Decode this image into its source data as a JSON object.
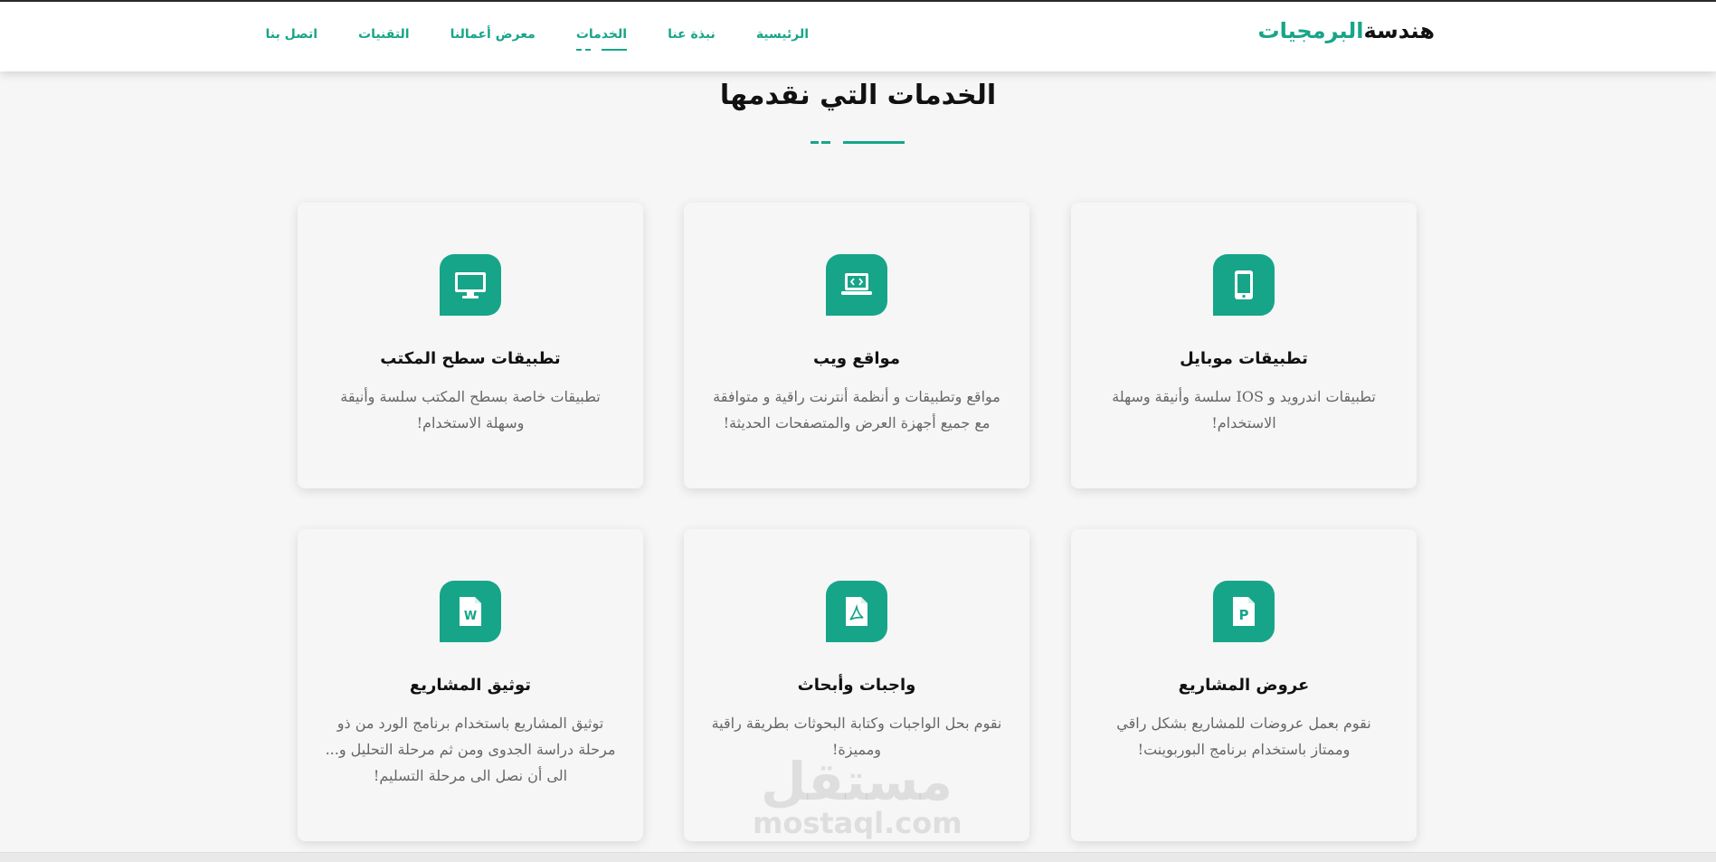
{
  "brand": {
    "part1": "هندسة",
    "part2": "البرمجيات"
  },
  "nav": {
    "items": [
      {
        "label": "الرئيسية"
      },
      {
        "label": "نبذة عنا"
      },
      {
        "label": "الخدمات",
        "active": true
      },
      {
        "label": "معرض أعمالنا"
      },
      {
        "label": "التقنيات"
      },
      {
        "label": "اتصل بنا"
      }
    ]
  },
  "section": {
    "title": "الخدمات التي نقدمها"
  },
  "services": [
    {
      "icon": "mobile-icon",
      "title": "تطبيقات موبايل",
      "desc": "تطبيقات اندرويد و IOS سلسة وأنيقة وسهلة الاستخدام!"
    },
    {
      "icon": "web-code-icon",
      "title": "مواقع ويب",
      "desc": "مواقع وتطبيقات و أنظمة أنترنت راقية و متوافقة مع جميع أجهزة العرض والمتصفحات الحديثة!"
    },
    {
      "icon": "desktop-icon",
      "title": "تطبيقات سطح المكتب",
      "desc": "تطبيقات خاصة بسطح المكتب سلسة وأنيقة وسهلة الاستخدام!"
    },
    {
      "icon": "powerpoint-file-icon",
      "title": "عروض المشاريع",
      "desc": "نقوم بعمل عروضات للمشاريع بشكل راقي وممتاز باستخدام برنامج البوربوينت!"
    },
    {
      "icon": "pdf-file-icon",
      "title": "واجبات وأبحاث",
      "desc": "نقوم بحل الواجبات وكتابة البحوثات بطريقة راقية ومميزة!"
    },
    {
      "icon": "word-file-icon",
      "title": "توثيق المشاريع",
      "desc": "توثيق المشاريع باستخدام برنامج الورد من ذو مرحلة دراسة الجدوى ومن ثم مرحلة التحليل و... الى أن نصل الى مرحلة التسليم!"
    }
  ],
  "watermark": {
    "arabic": "مستقل",
    "latin": "mostaql.com"
  },
  "colors": {
    "accent": "#17a589",
    "background": "#f6f6f6"
  }
}
